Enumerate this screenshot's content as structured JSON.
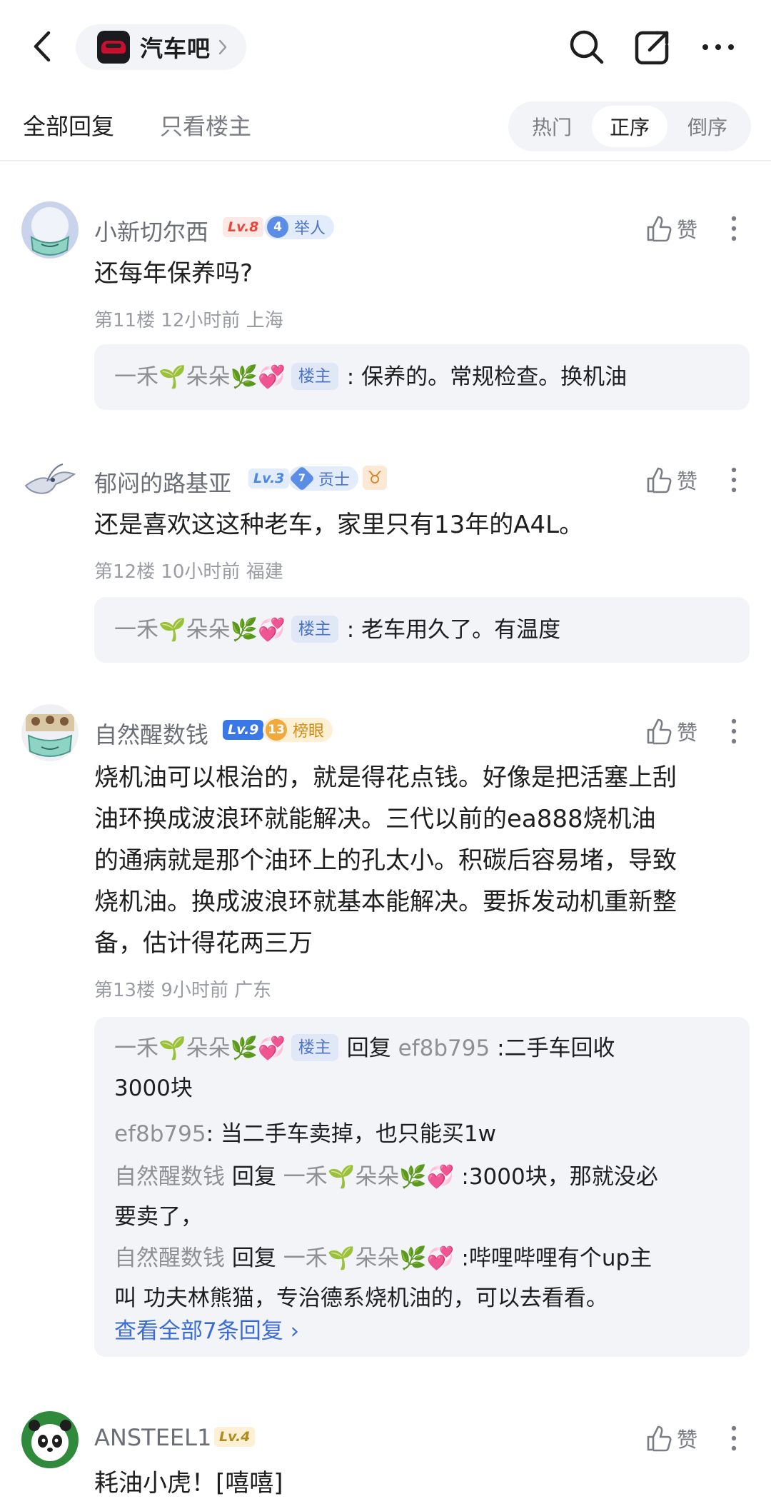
{
  "header": {
    "forum_name": "汽车吧"
  },
  "tabs": {
    "all": "全部回复",
    "owner_only": "只看楼主",
    "sort": [
      "热门",
      "正序",
      "倒序"
    ],
    "sort_selected": "正序"
  },
  "like_label": "赞",
  "owner_tag": "楼主",
  "reply_word": "回复",
  "posts": [
    {
      "user": "小新切尔西",
      "level": "Lv.8",
      "title_num": "4",
      "title": "举人",
      "text": "还每年保养吗?",
      "meta": "第11楼 12小时前 上海",
      "replies": [
        {
          "user": "一禾🌱朵朵🌿💞",
          "is_owner": true,
          "text": ": 保养的。常规检查。换机油"
        }
      ]
    },
    {
      "user": "郁闷的路基亚",
      "level": "Lv.3",
      "title_num": "7",
      "title": "贡士",
      "zodiac": "♉",
      "text": "还是喜欢这这种老车，家里只有13年的A4L。",
      "meta": "第12楼 10小时前 福建",
      "replies": [
        {
          "user": "一禾🌱朵朵🌿💞",
          "is_owner": true,
          "text": ": 老车用久了。有温度"
        }
      ]
    },
    {
      "user": "自然醒数钱",
      "level": "Lv.9",
      "title_num": "13",
      "title": "榜眼",
      "text_lines": [
        "烧机油可以根治的，就是得花点钱。好像是把活塞上刮",
        "油环换成波浪环就能解决。三代以前的ea888烧机油",
        "的通病就是那个油环上的孔太小。积碳后容易堵，导致",
        "烧机油。换成波浪环就基本能解决。要拆发动机重新整",
        "备，估计得花两三万"
      ],
      "meta": "第13楼 9小时前 广东",
      "replies": [
        {
          "user": "一禾🌱朵朵🌿💞",
          "is_owner": true,
          "to": "ef8b795",
          "text_a": ":二手车回收",
          "text_b": "3000块"
        },
        {
          "user": "ef8b795",
          "text": ": 当二手车卖掉，也只能买1w"
        },
        {
          "user": "自然醒数钱",
          "to": "一禾🌱朵朵🌿💞",
          "text_a": ":3000块，那就没必",
          "text_b": "要卖了，"
        },
        {
          "user": "自然醒数钱",
          "to": "一禾🌱朵朵🌿💞",
          "text_a": ":哔哩哔哩有个up主",
          "text_b": "叫 功夫林熊猫，专治德系烧机油的，可以去看看。"
        }
      ],
      "view_all": "查看全部7条回复"
    },
    {
      "user": "ANSTEEL1",
      "level": "Lv.4",
      "text": "耗油小虎！[嘻嘻]"
    }
  ],
  "colors": {
    "accent_blue": "#3a6bd6",
    "badge_lv8": "#e8483c",
    "badge_lv3": "#4b86e8",
    "badge_lv9": "#3b78e7",
    "badge_lv4": "#b38a1e"
  }
}
